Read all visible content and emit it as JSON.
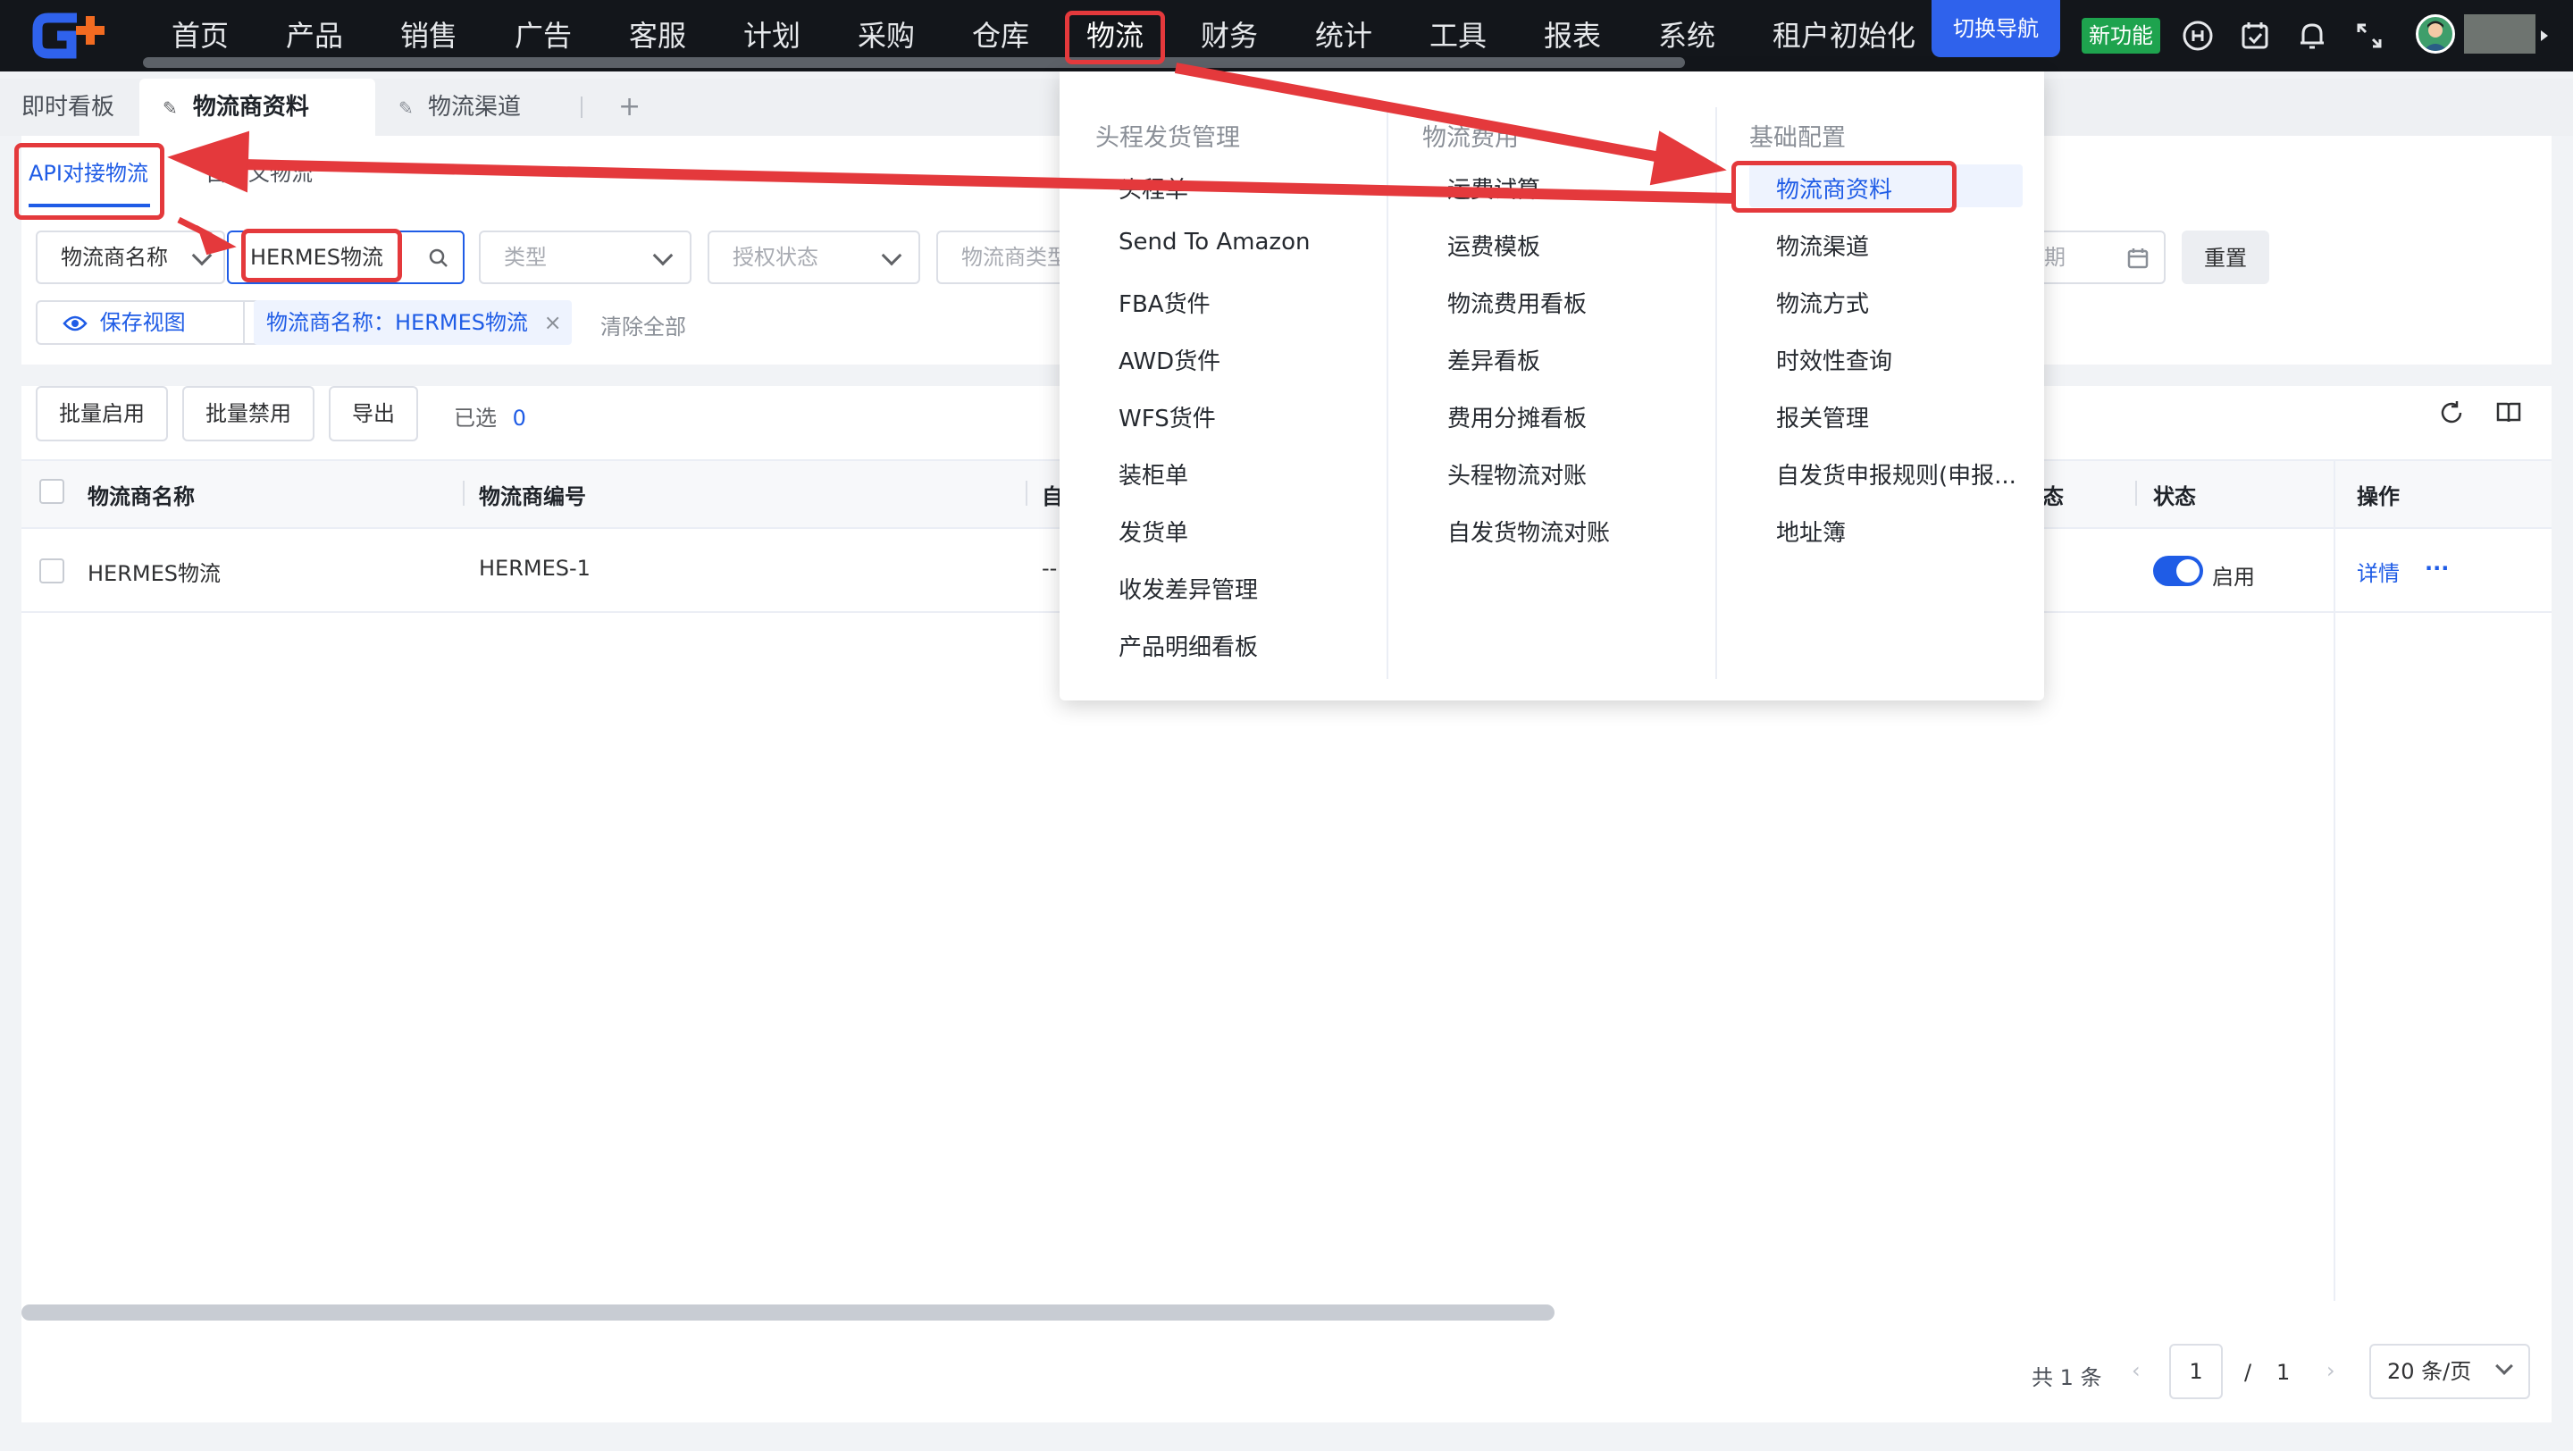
{
  "nav": {
    "items": [
      "首页",
      "产品",
      "销售",
      "广告",
      "客服",
      "计划",
      "采购",
      "仓库",
      "物流",
      "财务",
      "统计",
      "工具",
      "报表",
      "系统",
      "租户初始化"
    ],
    "switch_nav": "切换导航",
    "new_feature": "新功能"
  },
  "tabs": [
    "即时看板",
    "物流商资料",
    "物流渠道"
  ],
  "subtabs": [
    "API对接物流",
    "自定义物流"
  ],
  "filters": {
    "field_select": "物流商名称",
    "search_value": "HERMES物流",
    "type_placeholder": "类型",
    "auth_placeholder": "授权状态",
    "logistics_type_placeholder": "物流商类型",
    "date_placeholder": "期",
    "reset": "重置",
    "save_view": "保存视图",
    "active_tag": "物流商名称：HERMES物流",
    "clear_all": "清除全部"
  },
  "toolbar": {
    "enable": "批量启用",
    "disable": "批量禁用",
    "export": "导出",
    "selected_label": "已选",
    "selected_count": "0"
  },
  "table": {
    "headers": [
      "物流商名称",
      "物流商编号",
      "自",
      "态",
      "状态",
      "操作"
    ],
    "row": {
      "name": "HERMES物流",
      "code": "HERMES-1",
      "col3": "--",
      "status": "启用",
      "detail": "详情",
      "more": "···"
    }
  },
  "pagination": {
    "total": "共 1 条",
    "current": "1",
    "sep": "/",
    "pages": "1",
    "page_size": "20 条/页"
  },
  "dropdown": {
    "col1": {
      "title": "头程发货管理",
      "items": [
        "头程单",
        "Send To Amazon",
        "FBA货件",
        "AWD货件",
        "WFS货件",
        "装柜单",
        "发货单",
        "收发差异管理",
        "产品明细看板"
      ]
    },
    "col2": {
      "title": "物流费用",
      "items": [
        "运费试算",
        "运费模板",
        "物流费用看板",
        "差异看板",
        "费用分摊看板",
        "头程物流对账",
        "自发货物流对账"
      ]
    },
    "col3": {
      "title": "基础配置",
      "items": [
        "物流商资料",
        "物流渠道",
        "物流方式",
        "时效性查询",
        "报关管理",
        "自发货申报规则(申报...",
        "地址簿"
      ]
    }
  },
  "colors": {
    "primary": "#1f5ce6",
    "annotation_red": "#e4393c",
    "nav_bg": "#13161b",
    "success": "#1ea34e"
  }
}
